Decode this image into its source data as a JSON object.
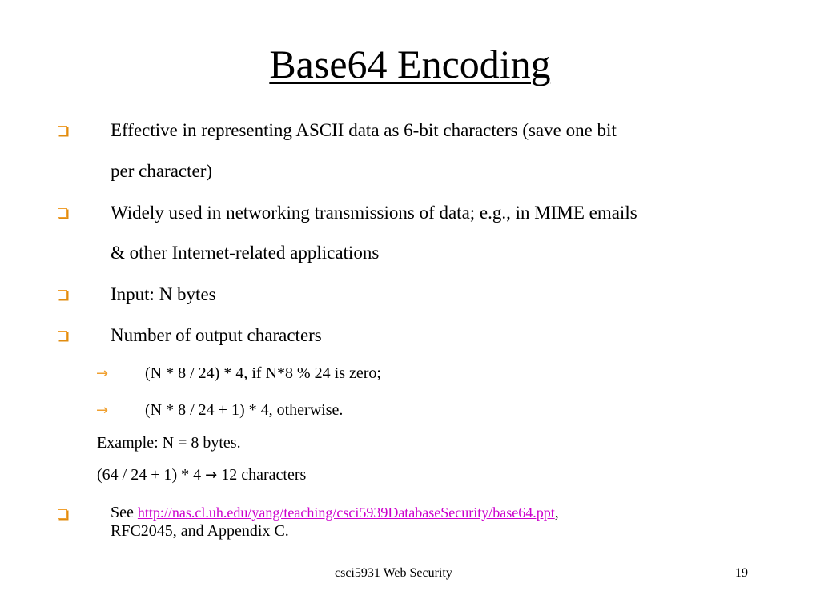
{
  "slide": {
    "title": "Base64 Encoding",
    "bullets": [
      {
        "line1": "Effective in representing ASCII data as 6-bit characters (save one bit",
        "line2": "per character)"
      },
      {
        "line1": "Widely used in networking transmissions of data; e.g., in MIME emails",
        "line2": "& other Internet-related applications"
      },
      {
        "line1": "Input: N bytes"
      },
      {
        "line1": "Number of output characters"
      }
    ],
    "sub_bullets": [
      "(N * 8 / 24) * 4, if N*8 % 24 is zero;",
      "(N * 8 / 24 + 1) * 4, otherwise."
    ],
    "example": {
      "line1": "Example: N = 8 bytes.",
      "line2_prefix": "(64 / 24 + 1) * 4 ",
      "arrow": "→",
      "line2_suffix": " 12 characters"
    },
    "see": {
      "prefix": "See ",
      "link_text": "http://nas.cl.uh.edu/yang/teaching/csci5939DatabaseSecurity/base64.ppt",
      "suffix": ",",
      "line2": "RFC2045, and Appendix C."
    },
    "footer": {
      "course": "csci5931 Web Security",
      "page_number": "19"
    },
    "colors": {
      "bullet": "#f0a030",
      "link": "#cc00cc"
    },
    "icons": {
      "bullet": "square-bullet-icon",
      "sub_bullet": "arrow-right-icon"
    }
  }
}
